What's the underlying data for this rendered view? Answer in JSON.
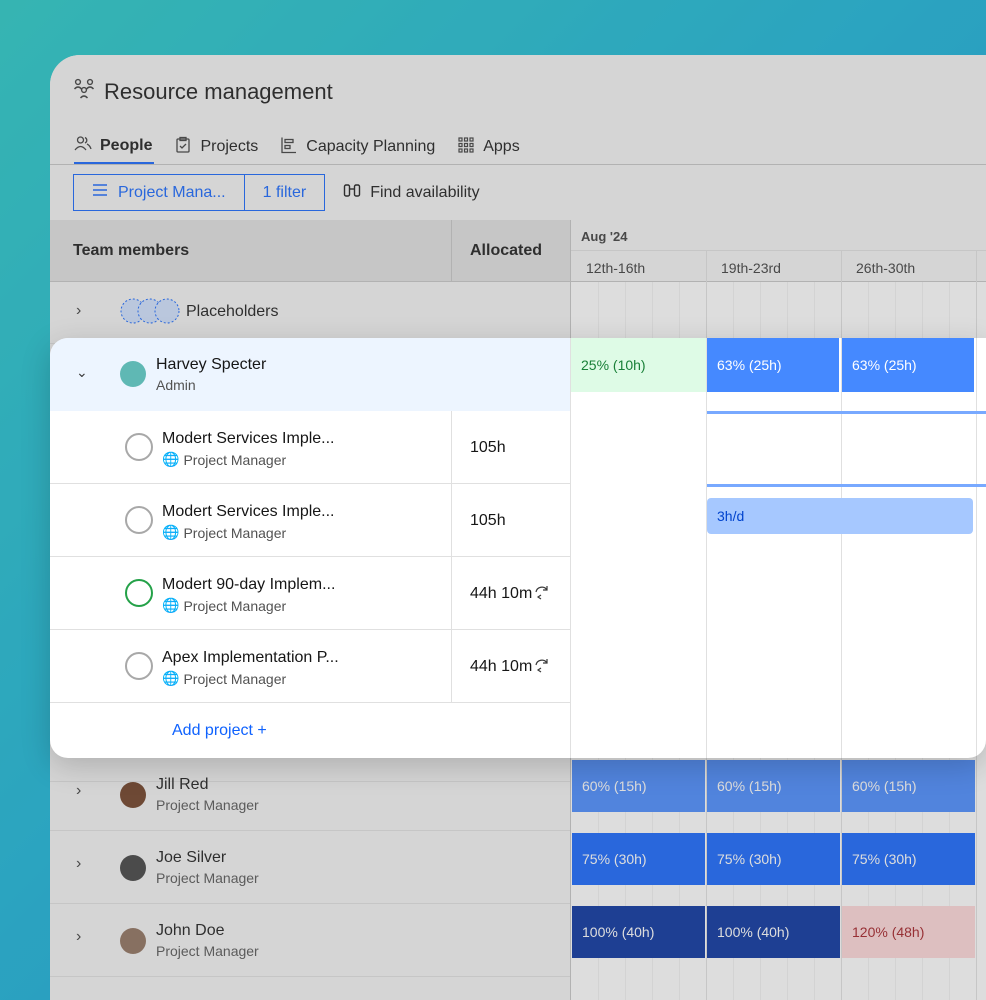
{
  "app": {
    "title": "Resource management"
  },
  "tabs": [
    {
      "label": "People",
      "icon": "people-icon",
      "active": true
    },
    {
      "label": "Projects",
      "icon": "clipboard-icon",
      "active": false
    },
    {
      "label": "Capacity Planning",
      "icon": "chart-icon",
      "active": false
    },
    {
      "label": "Apps",
      "icon": "apps-grid-icon",
      "active": false
    }
  ],
  "toolbar": {
    "view_label": "Project Mana...",
    "filter_label": "1 filter",
    "find_label": "Find availability"
  },
  "columns": {
    "team": "Team members",
    "allocated": "Allocated"
  },
  "calendar": {
    "month": "Aug '24",
    "weeks": [
      "12th-16th",
      "19th-23rd",
      "26th-30th"
    ]
  },
  "placeholders": {
    "label": "Placeholders"
  },
  "expanded": {
    "name": "Harvey Specter",
    "role": "Admin",
    "bars": [
      "25% (10h)",
      "63% (25h)",
      "63% (25h)"
    ],
    "projects": [
      {
        "title": "Modert Services Imple...",
        "role": "Project Manager",
        "allocated": "105h"
      },
      {
        "title": "Modert Services Imple...",
        "role": "Project Manager",
        "allocated": "105h",
        "bar": "3h/d"
      },
      {
        "title": "Modert 90-day Implem...",
        "role": "Project Manager",
        "allocated": "44h 10m"
      },
      {
        "title": "Apex Implementation P...",
        "role": "Project Manager",
        "allocated": "44h 10m"
      }
    ],
    "add_label": "Add project"
  },
  "people": [
    {
      "name": "Jill Red",
      "role": "Project Manager",
      "bars": [
        "60% (15h)",
        "60% (15h)",
        "60% (15h)"
      ]
    },
    {
      "name": "Joe Silver",
      "role": "Project Manager",
      "bars": [
        "75% (30h)",
        "75% (30h)",
        "75% (30h)"
      ]
    },
    {
      "name": "John Doe",
      "role": "Project Manager",
      "bars": [
        "100% (40h)",
        "100% (40h)",
        "120% (48h)"
      ]
    }
  ],
  "colors": {
    "accent": "#0f62fe"
  }
}
